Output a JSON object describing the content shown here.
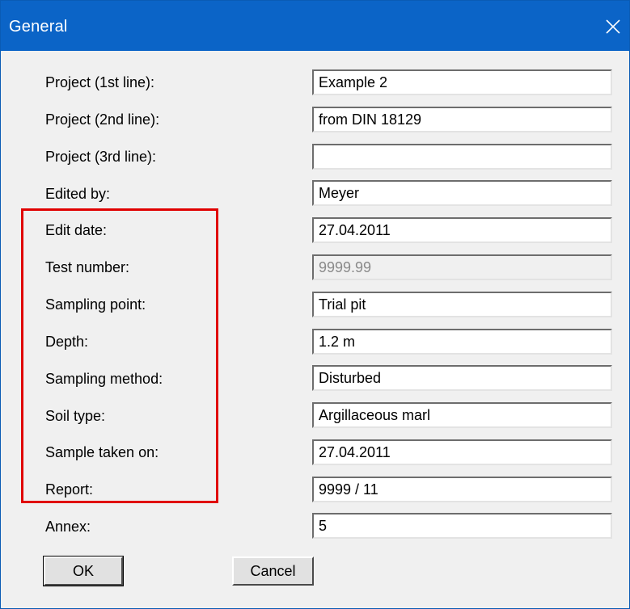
{
  "window": {
    "title": "General",
    "close_icon": "close-icon"
  },
  "fields": [
    {
      "key": "project1",
      "label": "Project (1st line):",
      "value": "Example 2",
      "enabled": true
    },
    {
      "key": "project2",
      "label": "Project (2nd line):",
      "value": "from DIN 18129",
      "enabled": true
    },
    {
      "key": "project3",
      "label": "Project (3rd line):",
      "value": "",
      "enabled": true
    },
    {
      "key": "edited_by",
      "label": "Edited by:",
      "value": "Meyer",
      "enabled": true
    },
    {
      "key": "edit_date",
      "label": "Edit date:",
      "value": "27.04.2011",
      "enabled": true
    },
    {
      "key": "test_number",
      "label": "Test number:",
      "value": "9999.99",
      "enabled": false
    },
    {
      "key": "sampling_point",
      "label": "Sampling point:",
      "value": "Trial pit",
      "enabled": true
    },
    {
      "key": "depth",
      "label": "Depth:",
      "value": "1.2 m",
      "enabled": true
    },
    {
      "key": "sampling_method",
      "label": "Sampling method:",
      "value": "Disturbed",
      "enabled": true
    },
    {
      "key": "soil_type",
      "label": "Soil type:",
      "value": "Argillaceous marl",
      "enabled": true
    },
    {
      "key": "sample_taken_on",
      "label": "Sample taken on:",
      "value": "27.04.2011",
      "enabled": true
    },
    {
      "key": "report",
      "label": "Report:",
      "value": "9999 / 11",
      "enabled": true
    },
    {
      "key": "annex",
      "label": "Annex:",
      "value": "5",
      "enabled": true
    }
  ],
  "buttons": {
    "ok_label": "OK",
    "cancel_label": "Cancel"
  },
  "colors": {
    "titlebar": "#0b64c7",
    "highlight_box": "#e00000",
    "dialog_bg": "#f0f0f0"
  }
}
